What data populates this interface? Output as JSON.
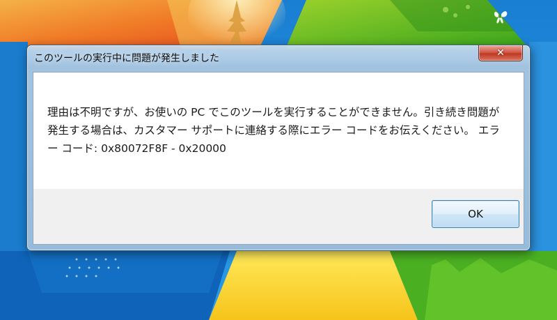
{
  "dialog": {
    "title": "このツールの実行中に問題が発生しました",
    "close_label": "✕",
    "message": "理由は不明ですが、お使いの PC でこのツールを実行することができません。引き続き問題が発生する場合は、カスタマー サポートに連絡する際にエラー コードをお伝えください。 エラー コード: 0x80072F8F - 0x20000",
    "ok_label": "OK"
  },
  "colors": {
    "desktop_blue": "#1f88d8",
    "dialog_frame": "#a9c6e0",
    "close_button_red": "#c7432e",
    "ok_button_border": "#3c7fb1",
    "content_background": "#ffffff",
    "button_area_background": "#f0f0f0"
  },
  "icons": {
    "close": "close-icon",
    "butterfly": "butterfly-icon"
  }
}
